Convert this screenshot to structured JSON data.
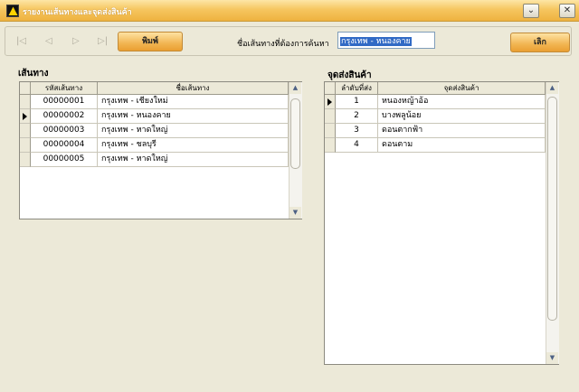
{
  "window": {
    "title": "รายงานเส้นทางและจุดส่งสินค้า",
    "minimize_glyph": "⌄",
    "close_glyph": "✕"
  },
  "toolbar": {
    "nav_first": "|◁",
    "nav_prev": "◁",
    "nav_next": "▷",
    "nav_last": "▷|",
    "print_label": "พิมพ์",
    "search_label": "ชื่อเส้นทางที่ต้องการค้นหา",
    "search_value": "กรุงเทพ - หนองคาย",
    "cancel_label": "เลิก"
  },
  "routes": {
    "title": "เส้นทาง",
    "columns": [
      "รหัสเส้นทาง",
      "ชื่อเส้นทาง"
    ],
    "rows": [
      {
        "code": "00000001",
        "name": "กรุงเทพ - เชียงใหม่"
      },
      {
        "code": "00000002",
        "name": "กรุงเทพ - หนองคาย"
      },
      {
        "code": "00000003",
        "name": "กรุงเทพ - หาดใหญ่"
      },
      {
        "code": "00000004",
        "name": "กรุงเทพ - ชลบุรี"
      },
      {
        "code": "00000005",
        "name": "กรุงเทพ - หาดใหญ่"
      }
    ]
  },
  "drops": {
    "title": "จุดส่งสินค้า",
    "columns": [
      "ลำดับที่ส่ง",
      "จุดส่งสินค้า"
    ],
    "rows": [
      {
        "seq": "1",
        "name": "หนองหญ้าอ้อ"
      },
      {
        "seq": "2",
        "name": "บางพลูน้อย"
      },
      {
        "seq": "3",
        "name": "ดอนตากฟ้า"
      },
      {
        "seq": "4",
        "name": "ดอนตาม"
      }
    ]
  },
  "colors": {
    "title_bar": "#f6c660",
    "button_orange": "#f2b552",
    "selection": "#316ac5",
    "face": "#ece9d8"
  },
  "icons": {
    "app": "triangle-warning-icon",
    "minimize": "minimize-icon",
    "close": "close-icon",
    "row_pointer": "row-pointer-icon"
  }
}
